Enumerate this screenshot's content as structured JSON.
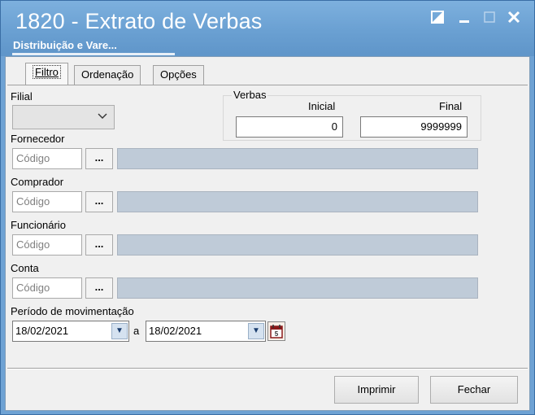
{
  "window": {
    "title": "1820 - Extrato de Verbas",
    "subtitle": "Distribuição e Vare..."
  },
  "tabs": [
    {
      "label": "Filtro",
      "active": true
    },
    {
      "label": "Ordenação",
      "active": false
    },
    {
      "label": "Opções",
      "active": false
    }
  ],
  "filial": {
    "label": "Filial",
    "value": ""
  },
  "verbas": {
    "label": "Verbas",
    "inicial_label": "Inicial",
    "inicial_value": "0",
    "final_label": "Final",
    "final_value": "9999999"
  },
  "fornecedor": {
    "label": "Fornecedor",
    "code_placeholder": "Código",
    "button": "..."
  },
  "comprador": {
    "label": "Comprador",
    "code_placeholder": "Código",
    "button": "..."
  },
  "funcionario": {
    "label": "Funcionário",
    "code_placeholder": "Código",
    "button": "..."
  },
  "conta": {
    "label": "Conta",
    "code_placeholder": "Código",
    "button": "..."
  },
  "periodo": {
    "label": "Período de movimentação",
    "start": "18/02/2021",
    "separator": "a",
    "end": "18/02/2021"
  },
  "footer": {
    "print_label": "Imprimir",
    "close_label": "Fechar"
  },
  "icons": {
    "restore": "restore-icon",
    "minimize": "minimize-icon",
    "maximize": "maximize-icon",
    "close": "close-icon",
    "calendar": "calendar-icon",
    "dropdown": "chevron-down-icon"
  }
}
